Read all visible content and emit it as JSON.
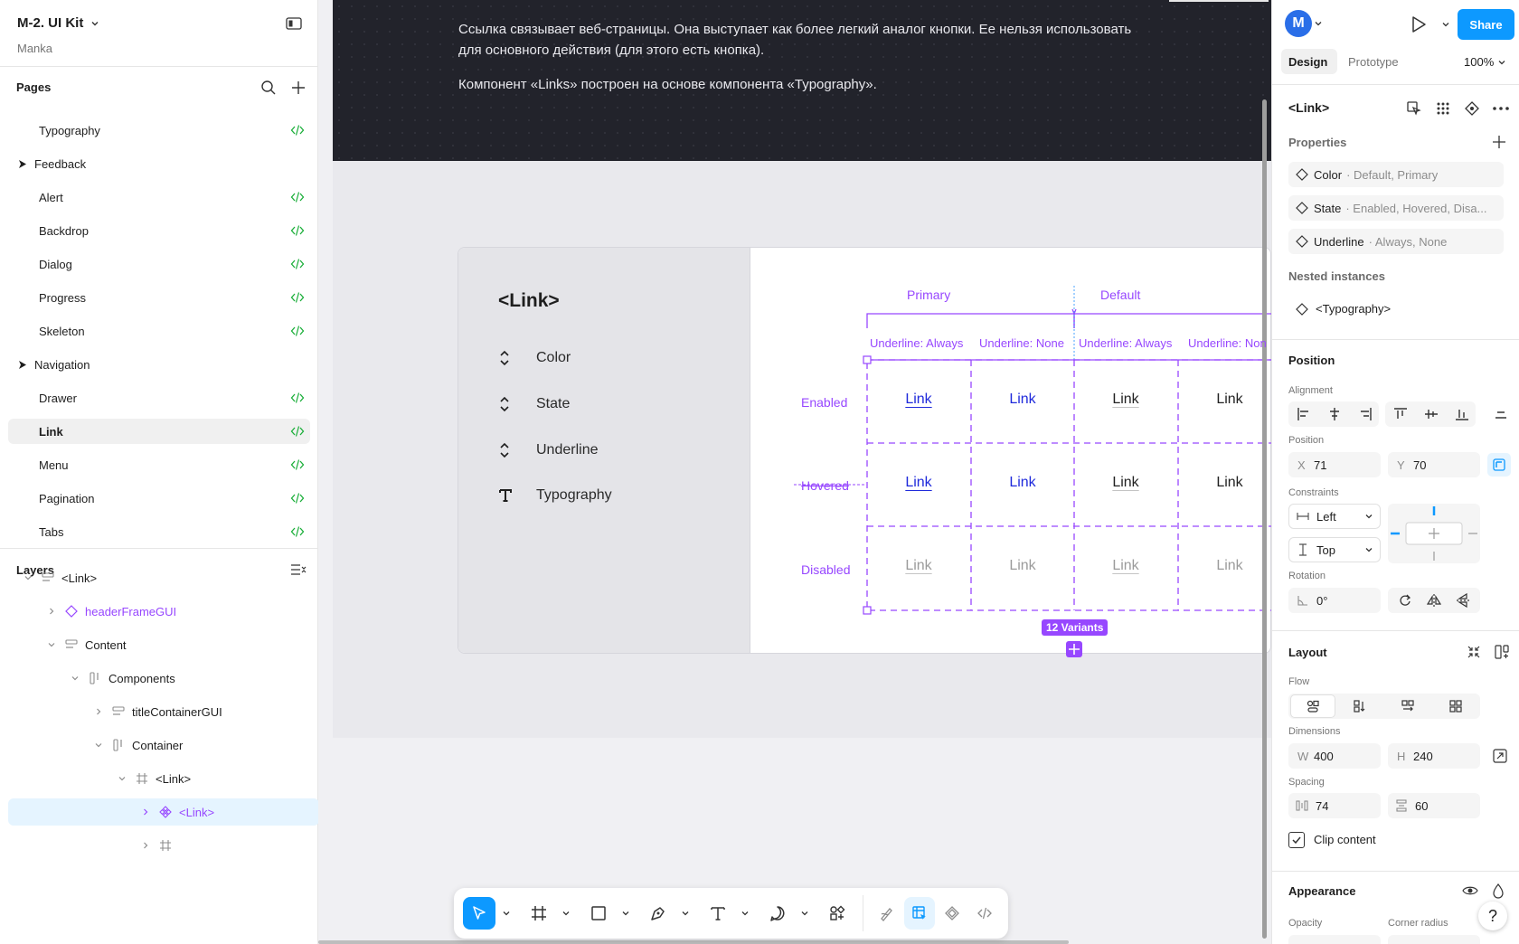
{
  "left": {
    "project_name": "M-2. UI Kit",
    "team": "Manka",
    "pages_heading": "Pages",
    "pages": [
      {
        "label": "Typography",
        "type": "page"
      },
      {
        "label": "Feedback",
        "type": "group"
      },
      {
        "label": "Alert",
        "type": "page"
      },
      {
        "label": "Backdrop",
        "type": "page"
      },
      {
        "label": "Dialog",
        "type": "page"
      },
      {
        "label": "Progress",
        "type": "page"
      },
      {
        "label": "Skeleton",
        "type": "page"
      },
      {
        "label": "Navigation",
        "type": "group"
      },
      {
        "label": "Drawer",
        "type": "page"
      },
      {
        "label": "Link",
        "type": "page",
        "selected": true
      },
      {
        "label": "Menu",
        "type": "page"
      },
      {
        "label": "Pagination",
        "type": "page"
      },
      {
        "label": "Tabs",
        "type": "page"
      }
    ],
    "layers_heading": "Layers",
    "layers": [
      {
        "label": "<Link>",
        "icon": "auto-layout-rows-icon"
      },
      {
        "label": "headerFrameGUI",
        "icon": "instance-icon"
      },
      {
        "label": "Content",
        "icon": "auto-layout-rows-icon"
      },
      {
        "label": "Components",
        "icon": "auto-layout-columns-icon"
      },
      {
        "label": "titleContainerGUI",
        "icon": "auto-layout-rows-icon"
      },
      {
        "label": "Container",
        "icon": "auto-layout-columns-icon"
      },
      {
        "label": "<Link>",
        "icon": "frame-icon"
      },
      {
        "label": "<Link>",
        "icon": "component-set-icon",
        "selected": true
      },
      {
        "label": "",
        "icon": "frame-icon"
      }
    ]
  },
  "canvas": {
    "banner_p1": "Ссылка связывает веб-страницы. Она выступает как более легкий аналог кнопки. Ее нельзя использовать для основного действия (для этого есть кнопка).",
    "banner_p2": "Компонент «Links» построен на основе компонента «Typography».",
    "card_title": "<Link>",
    "card_props": [
      {
        "label": "Color",
        "icon": "variant-toggle-icon"
      },
      {
        "label": "State",
        "icon": "variant-toggle-icon"
      },
      {
        "label": "Underline",
        "icon": "variant-toggle-icon"
      },
      {
        "label": "Typography",
        "icon": "text-icon"
      }
    ],
    "col_groups": [
      "Primary",
      "Default"
    ],
    "col_labels": [
      "Underline: Always",
      "Underline: None",
      "Underline: Always",
      "Underline: Non"
    ],
    "row_labels": [
      "Enabled",
      "Hovered",
      "Disabled"
    ],
    "link_text": "Link",
    "variants_badge": "12 Variants",
    "colors": {
      "primary": "#1f2adb",
      "default": "#222222",
      "disabled": "#9b9b9b",
      "variant": "#9747ff"
    }
  },
  "toolbar": {
    "tools": [
      "move-tool",
      "frame-tool",
      "shape-tool",
      "pen-tool",
      "text-tool",
      "comment-tool",
      "actions-tool",
      "draw-mode",
      "design-mode",
      "dev-components",
      "dev-mode"
    ]
  },
  "right": {
    "avatar_letter": "M",
    "share": "Share",
    "tab_design": "Design",
    "tab_prototype": "Prototype",
    "zoom": "100%",
    "component_name": "<Link>",
    "properties_heading": "Properties",
    "properties": [
      {
        "name": "Color",
        "values": "· Default, Primary"
      },
      {
        "name": "State",
        "values": "· Enabled, Hovered, Disa..."
      },
      {
        "name": "Underline",
        "values": "· Always, None"
      }
    ],
    "nested_heading": "Nested instances",
    "nested_item": "<Typography>",
    "position_heading": "Position",
    "alignment_label": "Alignment",
    "position_label": "Position",
    "x_key": "X",
    "x_value": "71",
    "y_key": "Y",
    "y_value": "70",
    "constraints_label": "Constraints",
    "constraint_h": "Left",
    "constraint_v": "Top",
    "rotation_label": "Rotation",
    "rotation_value": "0°",
    "layout_heading": "Layout",
    "flow_label": "Flow",
    "dimensions_label": "Dimensions",
    "w_key": "W",
    "w_value": "400",
    "h_key": "H",
    "h_value": "240",
    "spacing_label": "Spacing",
    "spacing_h": "74",
    "spacing_v": "60",
    "clip_content": "Clip content",
    "appearance_heading": "Appearance",
    "opacity_label": "Opacity",
    "corner_radius_label": "Corner radius",
    "help": "?"
  }
}
